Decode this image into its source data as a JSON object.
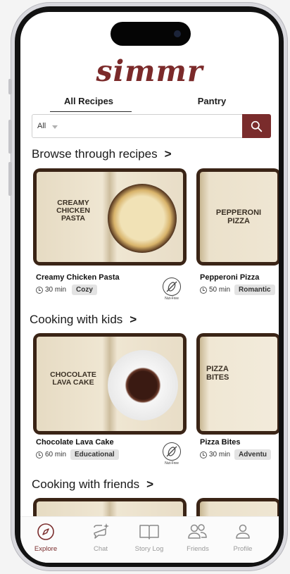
{
  "app": {
    "logo": "simmr"
  },
  "tabs": {
    "all_recipes": "All Recipes",
    "pantry": "Pantry"
  },
  "search": {
    "filter_value": "All",
    "placeholder": ""
  },
  "sections": [
    {
      "title": "Browse through recipes",
      "cards": [
        {
          "cover": "CREAMY\nCHICKEN\nPASTA",
          "name": "Creamy Chicken Pasta",
          "time": "30 min",
          "tag": "Cozy",
          "badge": "Nut-Free"
        },
        {
          "cover": "PEPPERONI\nPIZZA",
          "name": "Pepperoni Pizza",
          "time": "50 min",
          "tag": "Romantic"
        }
      ]
    },
    {
      "title": "Cooking with kids",
      "cards": [
        {
          "cover": "CHOCOLATE\nLAVA CAKE",
          "name": "Chocolate Lava Cake",
          "time": "60 min",
          "tag": "Educational",
          "badge": "Nut-Free"
        },
        {
          "cover": "PIZZA\nBITES",
          "name": "Pizza Bites",
          "time": "30 min",
          "tag": "Adventu"
        }
      ]
    },
    {
      "title": "Cooking with friends"
    }
  ],
  "nav": [
    {
      "label": "Explore",
      "icon": "compass-icon",
      "active": true
    },
    {
      "label": "Chat",
      "icon": "chat-sparkle-icon"
    },
    {
      "label": "Story Log",
      "icon": "book-icon"
    },
    {
      "label": "Friends",
      "icon": "friends-icon"
    },
    {
      "label": "Profile",
      "icon": "profile-icon"
    }
  ],
  "colors": {
    "brand": "#7b2a2a",
    "accent": "#7a2c2c",
    "tag_bg": "#e3e3e3"
  }
}
